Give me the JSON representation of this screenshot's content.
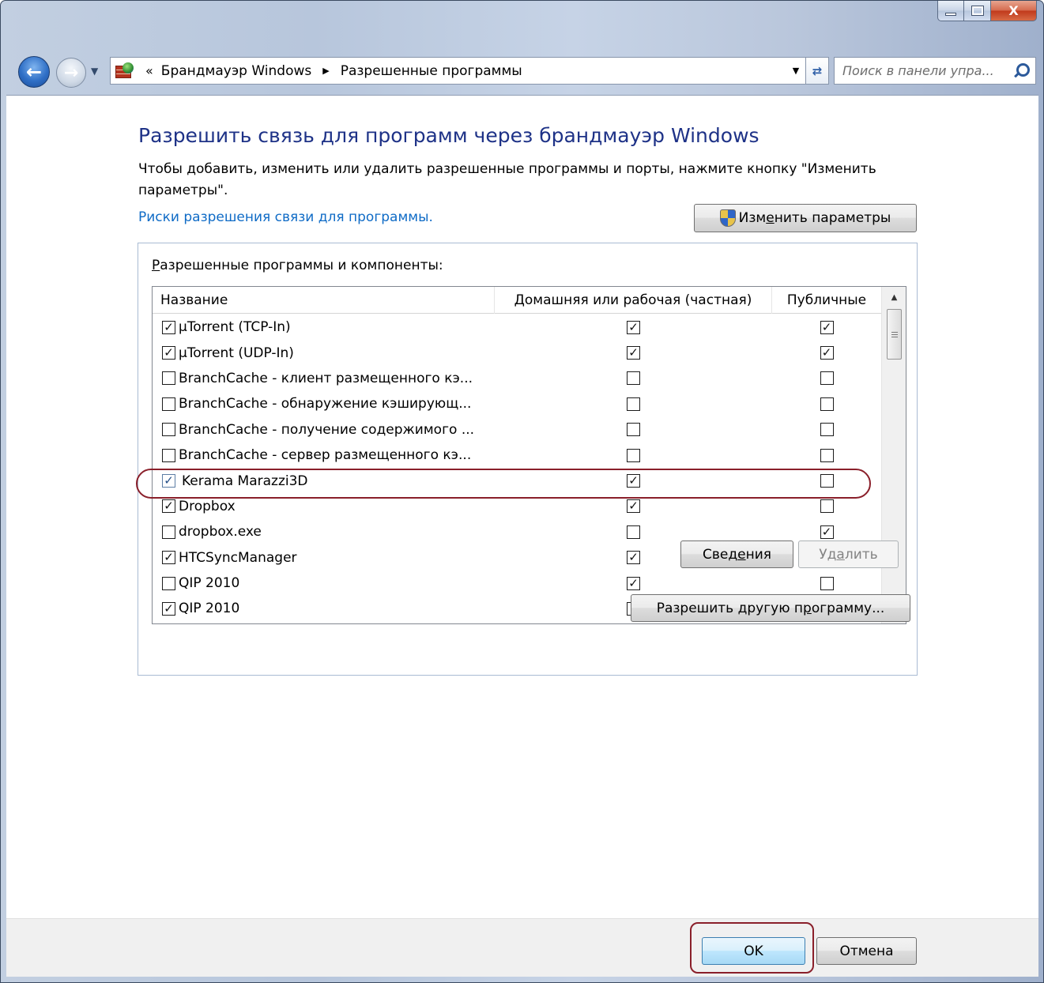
{
  "window": {
    "minimize": "minimize",
    "maximize": "maximize",
    "close": "X"
  },
  "nav": {
    "breadcrumb_prefix": "«",
    "crumbs": [
      "Брандмауэр Windows",
      "Разрешенные программы"
    ],
    "search_placeholder": "Поиск в панели упра..."
  },
  "page": {
    "title": "Разрешить связь для программ через брандмауэр Windows",
    "description": "Чтобы добавить, изменить или удалить разрешенные программы и порты, нажмите кнопку \"Изменить параметры\".",
    "risk_link": "Риски разрешения связи для программы.",
    "change_settings": {
      "pre": "Изм",
      "u": "е",
      "post": "нить параметры"
    }
  },
  "group": {
    "title": {
      "u": "Р",
      "post": "азрешенные программы и компоненты:"
    },
    "columns": {
      "name": "Название",
      "private": "Домашняя или рабочая (частная)",
      "public": "Публичные"
    },
    "rows": [
      {
        "name": "µTorrent (TCP-In)",
        "enabled": true,
        "private": true,
        "public": true
      },
      {
        "name": "µTorrent (UDP-In)",
        "enabled": true,
        "private": true,
        "public": true
      },
      {
        "name": "BranchCache - клиент размещенного кэ...",
        "enabled": false,
        "private": false,
        "public": false
      },
      {
        "name": "BranchCache - обнаружение кэширующ...",
        "enabled": false,
        "private": false,
        "public": false
      },
      {
        "name": "BranchCache - получение содержимого ...",
        "enabled": false,
        "private": false,
        "public": false
      },
      {
        "name": "BranchCache - сервер размещенного кэ...",
        "enabled": false,
        "private": false,
        "public": false
      },
      {
        "name": "Kerama Marazzi3D",
        "enabled": true,
        "private": true,
        "public": false
      },
      {
        "name": "Dropbox",
        "enabled": true,
        "private": true,
        "public": false
      },
      {
        "name": "dropbox.exe",
        "enabled": false,
        "private": false,
        "public": true
      },
      {
        "name": "HTCSyncManager",
        "enabled": true,
        "private": true,
        "public": true
      },
      {
        "name": "QIP 2010",
        "enabled": false,
        "private": true,
        "public": false
      },
      {
        "name": "QIP 2010",
        "enabled": true,
        "private": false,
        "public": true
      }
    ],
    "details": {
      "pre": "Свед",
      "u": "е",
      "post": "ния"
    },
    "remove": {
      "pre": "Уд",
      "u": "а",
      "post": "лить"
    }
  },
  "allow_other": {
    "pre": "Разрешить другую п",
    "u": "р",
    "post": "ограмму..."
  },
  "footer": {
    "ok": "OK",
    "cancel": "Отмена"
  }
}
